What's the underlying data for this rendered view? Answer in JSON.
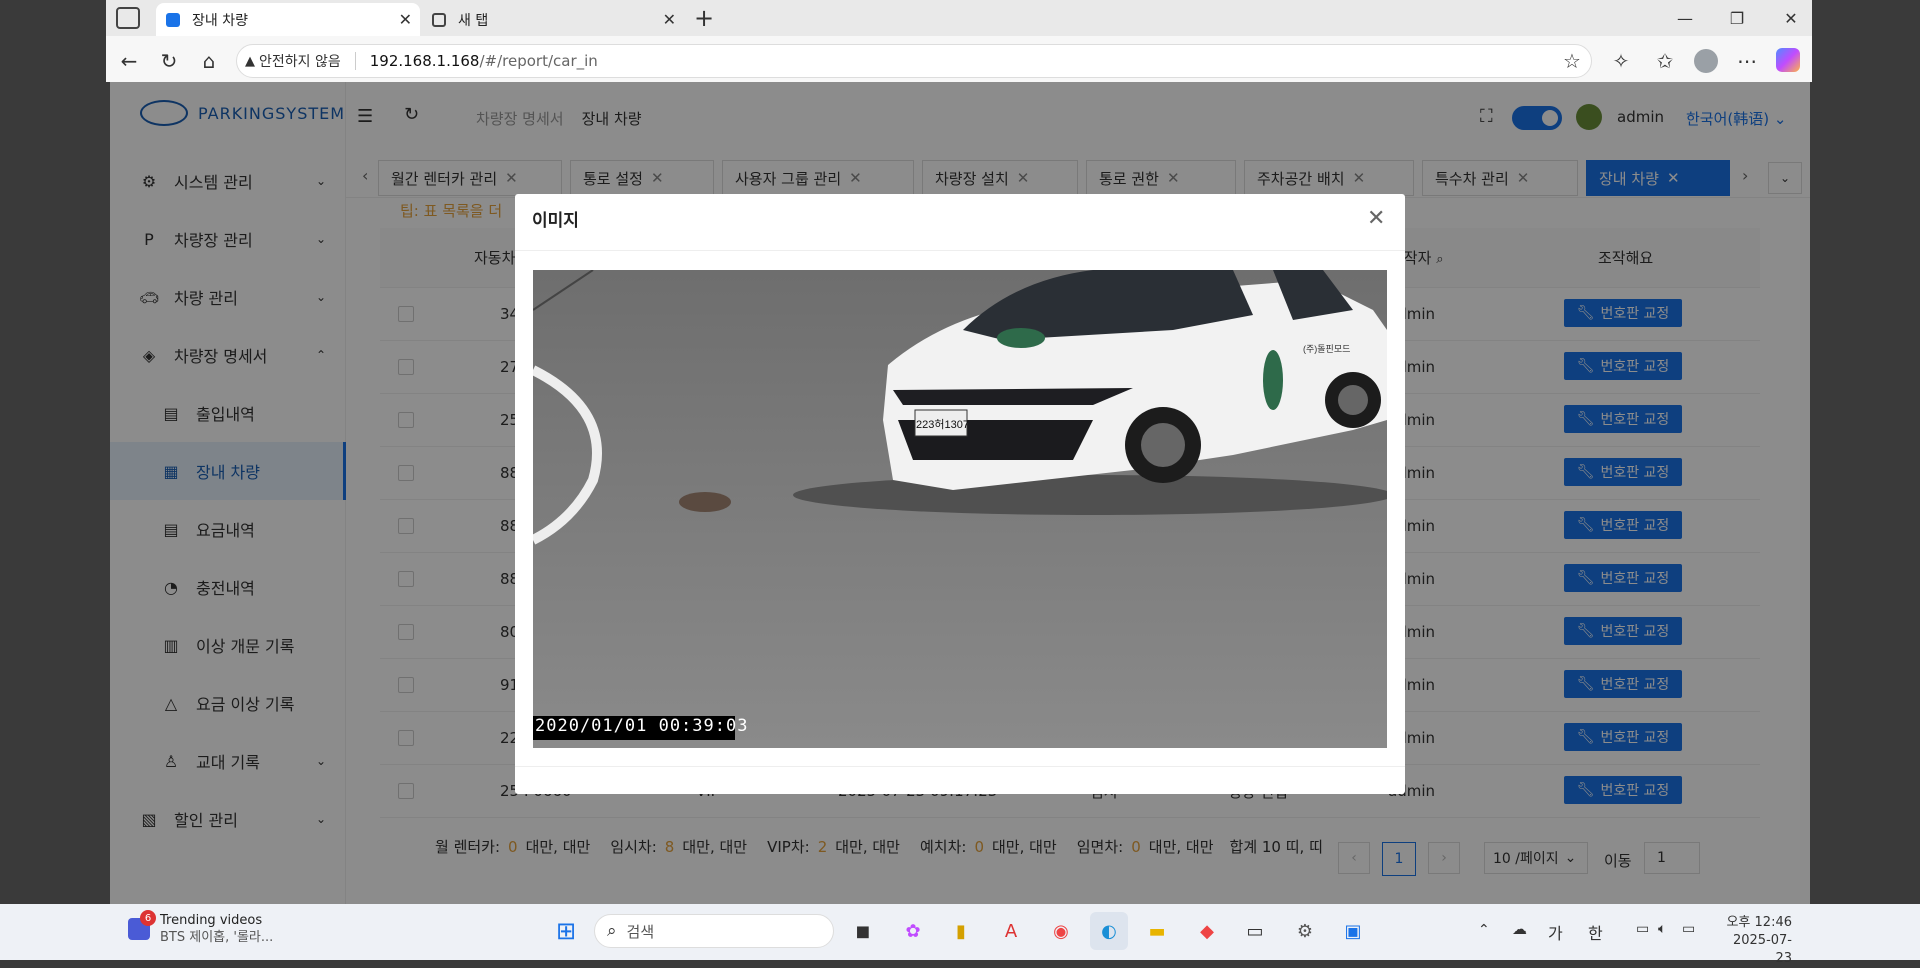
{
  "browser": {
    "tabs": [
      {
        "title": "장내 차량",
        "active": true
      },
      {
        "title": "새 탭",
        "active": false
      }
    ],
    "security_label": "안전하지 않음",
    "url_host": "192.168.1.168",
    "url_path": "/#/report/car_in",
    "accent": "#1a73e8"
  },
  "app": {
    "logo_text": "PARKINGSYSTEM",
    "breadcrumb": [
      "차량장 명세서",
      "장내 차량"
    ],
    "user": "admin",
    "language": "한국어(韩语)",
    "sidebar": [
      {
        "label": "시스템 관리",
        "icon": "gear-icon",
        "chevron": "⌄"
      },
      {
        "label": "차량장 관리",
        "icon": "parking-icon",
        "chevron": "⌄"
      },
      {
        "label": "차량 관리",
        "icon": "car-icon",
        "chevron": "⌄"
      },
      {
        "label": "차량장 명세서",
        "icon": "layers-icon",
        "chevron": "⌃"
      },
      {
        "label": "출입내역",
        "icon": "doc-icon",
        "sub": true
      },
      {
        "label": "장내 차량",
        "icon": "car-doc-icon",
        "sub": true,
        "active": true
      },
      {
        "label": "요금내역",
        "icon": "bill-icon",
        "sub": true
      },
      {
        "label": "충전내역",
        "icon": "charge-icon",
        "sub": true
      },
      {
        "label": "이상 개문 기록",
        "icon": "door-icon",
        "sub": true
      },
      {
        "label": "요금 이상 기록",
        "icon": "warning-icon",
        "sub": true
      },
      {
        "label": "교대 기록",
        "icon": "person-icon",
        "sub": true,
        "chevron": "⌄"
      },
      {
        "label": "할인 관리",
        "icon": "discount-icon",
        "chevron": "⌄"
      }
    ],
    "page_tabs": [
      "월간 렌터카 관리",
      "통로 설정",
      "사용자 그룹 관리",
      "차량장 설치",
      "통로 권한",
      "주차공간 배치",
      "특수차 관리",
      "장내 차량"
    ],
    "tip": "팁: 표 목록을 더",
    "columns": {
      "plate": "자동차",
      "operator": "조작자",
      "action": "조작해요"
    },
    "rows": [
      {
        "plate": "34",
        "operator": "admin"
      },
      {
        "plate": "27",
        "operator": "admin"
      },
      {
        "plate": "25",
        "operator": "admin"
      },
      {
        "plate": "88",
        "operator": "admin"
      },
      {
        "plate": "88",
        "operator": "admin"
      },
      {
        "plate": "88",
        "operator": "admin"
      },
      {
        "plate": "80",
        "operator": "admin"
      },
      {
        "plate": "91",
        "operator": "admin"
      },
      {
        "plate": "22",
        "operator": "admin"
      },
      {
        "plate": "25 ⁞ 0660",
        "type": "VIP",
        "time": "2025-07-23 09:17:23",
        "fee": "임시",
        "status": "정상 진입",
        "operator": "admin"
      }
    ],
    "fix_button": "번호판 교정",
    "summary": {
      "monthly_label": "월 렌터카:",
      "monthly_count": "0",
      "monthly_unit": "대만, 대만",
      "temp_label": "임시차:",
      "temp_count": "8",
      "temp_unit": "대만, 대만",
      "vip_label": "VIP차:",
      "vip_count": "2",
      "vip_unit": "대만, 대만",
      "reserve_label": "예치차:",
      "reserve_count": "0",
      "reserve_unit": "대만, 대만",
      "free_label": "임면차:",
      "free_count": "0",
      "free_unit": "대만, 대만",
      "total": "합계 10 띠, 띠"
    },
    "pagination": {
      "page": "1",
      "page_size": "10 /페이지",
      "goto_label": "이동",
      "goto_value": "1"
    }
  },
  "modal": {
    "title": "이미지",
    "timestamp": "2020/01/01 00:39:03",
    "plate_text": "223허1307",
    "door_text": "(주)돌핀모드"
  },
  "taskbar": {
    "notif_count": "6",
    "news_title": "Trending videos",
    "news_sub": "BTS 제이홉, '롤라...",
    "search_placeholder": "검색",
    "ime1": "가",
    "ime2": "한",
    "time": "오후 12:46",
    "date": "2025-07-23"
  }
}
